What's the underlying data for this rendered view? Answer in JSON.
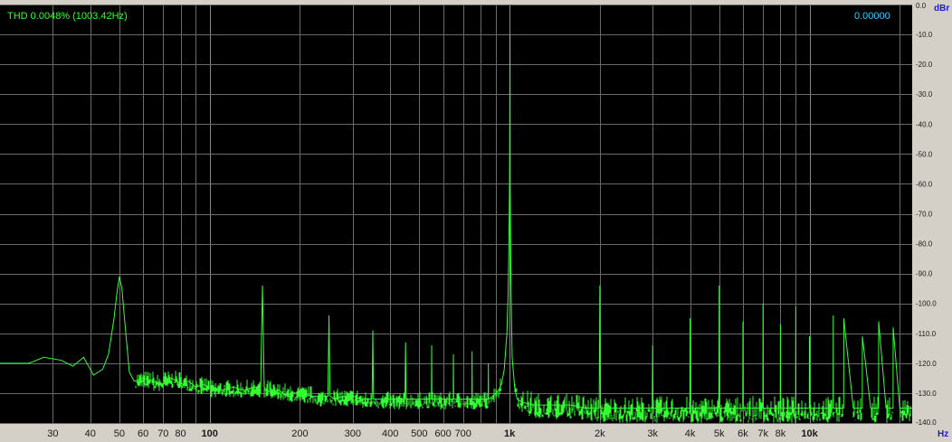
{
  "thd_readout": "THD 0.0048% (1003.42Hz)",
  "level_readout": "0.00000",
  "colors": {
    "plot_background": "#000000",
    "trace": "#33ff33",
    "readout_left": "#33ff33",
    "readout_right": "#33ccff",
    "unit_label": "#1a1ad0",
    "frame": "#d4d0c8"
  },
  "chart_data": {
    "type": "line",
    "xscale": "log",
    "xlim": [
      20,
      22000
    ],
    "ylim": [
      -140,
      0
    ],
    "grid": true,
    "y_unit": "dBr",
    "x_unit": "Hz",
    "x_ticks": [
      {
        "value": 30,
        "label": "30",
        "bold": false
      },
      {
        "value": 40,
        "label": "40",
        "bold": false
      },
      {
        "value": 50,
        "label": "50",
        "bold": false
      },
      {
        "value": 60,
        "label": "60",
        "bold": false
      },
      {
        "value": 70,
        "label": "70",
        "bold": false
      },
      {
        "value": 80,
        "label": "80",
        "bold": false
      },
      {
        "value": 100,
        "label": "100",
        "bold": true
      },
      {
        "value": 200,
        "label": "200",
        "bold": false
      },
      {
        "value": 300,
        "label": "300",
        "bold": false
      },
      {
        "value": 400,
        "label": "400",
        "bold": false
      },
      {
        "value": 500,
        "label": "500",
        "bold": false
      },
      {
        "value": 600,
        "label": "600",
        "bold": false
      },
      {
        "value": 700,
        "label": "700",
        "bold": false
      },
      {
        "value": 1000,
        "label": "1k",
        "bold": true
      },
      {
        "value": 2000,
        "label": "2k",
        "bold": false
      },
      {
        "value": 3000,
        "label": "3k",
        "bold": false
      },
      {
        "value": 4000,
        "label": "4k",
        "bold": false
      },
      {
        "value": 5000,
        "label": "5k",
        "bold": false
      },
      {
        "value": 6000,
        "label": "6k",
        "bold": false
      },
      {
        "value": 7000,
        "label": "7k",
        "bold": false
      },
      {
        "value": 8000,
        "label": "8k",
        "bold": false
      },
      {
        "value": 10000,
        "label": "10k",
        "bold": true
      }
    ],
    "y_ticks": [
      {
        "value": 0,
        "label": "0.0"
      },
      {
        "value": -10,
        "label": "-10.0"
      },
      {
        "value": -20,
        "label": "-20.0"
      },
      {
        "value": -30,
        "label": "-30.0"
      },
      {
        "value": -40,
        "label": "-40.0"
      },
      {
        "value": -50,
        "label": "-50.0"
      },
      {
        "value": -60,
        "label": "-60.0"
      },
      {
        "value": -70,
        "label": "-70.0"
      },
      {
        "value": -80,
        "label": "-80.0"
      },
      {
        "value": -90,
        "label": "-90.0"
      },
      {
        "value": -100,
        "label": "-100.0"
      },
      {
        "value": -110,
        "label": "-110.0"
      },
      {
        "value": -120,
        "label": "-120.0"
      },
      {
        "value": -130,
        "label": "-130.0"
      },
      {
        "value": -140,
        "label": "-140.0"
      }
    ],
    "series": [
      {
        "x": [
          20,
          25,
          28,
          32,
          35,
          38,
          41,
          44,
          46,
          48,
          49,
          50,
          51,
          52,
          54,
          56,
          60,
          65,
          70,
          75,
          80,
          85,
          90,
          95,
          100,
          110,
          120,
          130,
          140,
          148,
          149,
          150,
          151,
          152,
          160,
          170,
          180,
          190,
          200,
          220,
          240,
          248,
          249,
          250,
          251,
          252,
          260,
          280,
          300,
          320,
          340,
          348,
          349,
          350,
          351,
          352,
          370,
          400,
          420,
          448,
          449,
          450,
          451,
          452,
          480,
          500,
          520,
          549,
          550,
          551,
          580,
          600,
          620,
          649,
          650,
          651,
          680,
          700,
          720,
          749,
          750,
          751,
          780,
          800,
          849,
          850,
          851,
          880,
          900,
          920,
          940,
          960,
          980,
          990,
          995,
          1000,
          1003.42,
          1005,
          1010,
          1020,
          1040,
          1060,
          1100,
          1200,
          1400,
          1600,
          1800,
          1990,
          2000,
          2010,
          2200,
          2500,
          2800,
          2990,
          3000,
          3010,
          3300,
          3600,
          3990,
          4000,
          4010,
          4500,
          4990,
          5000,
          5010,
          5500,
          5990,
          6000,
          6010,
          6500,
          6990,
          7000,
          7010,
          7500,
          7990,
          8000,
          8010,
          8500,
          8990,
          9000,
          9010,
          9500,
          9990,
          10000,
          10010,
          11000,
          11990,
          12000,
          12010,
          12990,
          13000,
          13010,
          14000,
          14990,
          15000,
          15010,
          16000,
          16990,
          17000,
          17010,
          18000,
          18990,
          19000,
          19010,
          20000,
          21000,
          22000
        ],
        "y": [
          -120,
          -120,
          -118,
          -119,
          -121,
          -118,
          -124,
          -122,
          -117,
          -105,
          -97,
          -91,
          -95,
          -105,
          -123,
          -126,
          -125,
          -126,
          -127,
          -125,
          -127,
          -126,
          -128,
          -127,
          -128,
          -129,
          -128,
          -129,
          -128,
          -128,
          -110,
          -94,
          -110,
          -128,
          -130,
          -129,
          -131,
          -130,
          -130,
          -131,
          -131,
          -131,
          -118,
          -104,
          -118,
          -131,
          -132,
          -131,
          -131,
          -132,
          -132,
          -132,
          -121,
          -109,
          -121,
          -132,
          -132,
          -132,
          -132,
          -132,
          -122,
          -113,
          -122,
          -132,
          -132,
          -132,
          -132,
          -132,
          -114,
          -132,
          -132,
          -132,
          -132,
          -132,
          -117,
          -132,
          -132,
          -132,
          -132,
          -132,
          -116,
          -132,
          -132,
          -132,
          -132,
          -120,
          -132,
          -131,
          -130,
          -129,
          -127,
          -122,
          -110,
          -95,
          -80,
          -60,
          -10,
          -60,
          -90,
          -118,
          -128,
          -132,
          -133,
          -134,
          -134,
          -134,
          -135,
          -135,
          -94,
          -135,
          -135,
          -135,
          -135,
          -135,
          -114,
          -135,
          -135,
          -135,
          -135,
          -105,
          -135,
          -135,
          -135,
          -94,
          -135,
          -135,
          -135,
          -106,
          -135,
          -135,
          -135,
          -100,
          -135,
          -135,
          -135,
          -107,
          -135,
          -135,
          -135,
          -101,
          -135,
          -135,
          -135,
          -111,
          -135,
          -135,
          -135,
          -104,
          -135,
          -135,
          -135,
          -105,
          -135,
          -135,
          -135,
          -111,
          -135,
          -135,
          -135,
          -106,
          -135,
          -135,
          -135,
          -108,
          -135,
          -135,
          -135
        ]
      }
    ]
  }
}
